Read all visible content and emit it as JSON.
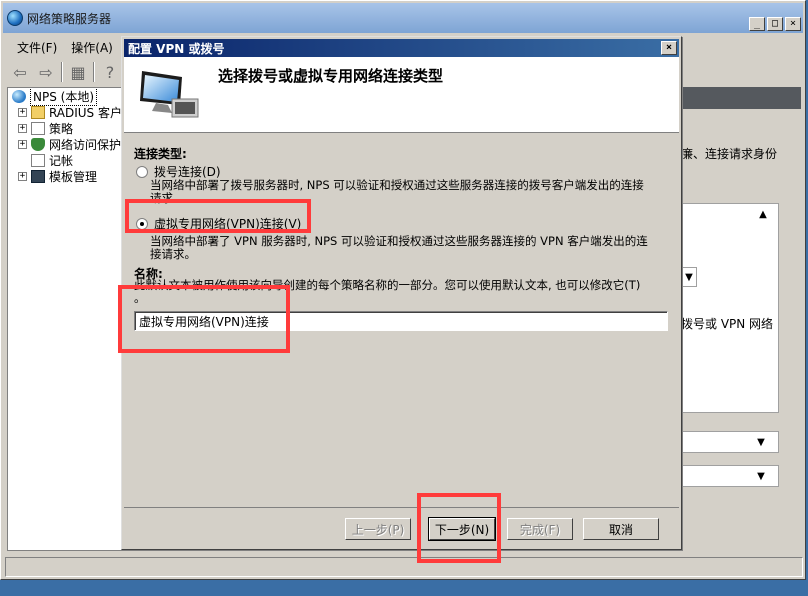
{
  "main_window": {
    "title": "网络策略服务器",
    "buttons": {
      "minimize": "_",
      "maximize": "□",
      "close": "×"
    }
  },
  "menu": {
    "file": "文件(F)",
    "action": "操作(A)"
  },
  "tree": {
    "root": "NPS (本地)",
    "items": [
      {
        "label": "RADIUS 客户",
        "icon": "folder-icon"
      },
      {
        "label": "策略",
        "icon": "document-icon"
      },
      {
        "label": "网络访问保护",
        "icon": "shield-icon"
      },
      {
        "label": "记帐",
        "icon": "document-icon"
      },
      {
        "label": "模板管理",
        "icon": "monitor-icon"
      }
    ]
  },
  "right_pane": {
    "text_top": "廉、连接请求身份",
    "text_mid": "拨号或 VPN 网络"
  },
  "dialog": {
    "title": "配置 VPN 或拨号",
    "heading": "选择拨号或虚拟专用网络连接类型",
    "connection_type_label": "连接类型:",
    "options": [
      {
        "label": "拨号连接(D)",
        "selected": false,
        "desc_line1": "当网络中部署了拨号服务器时, NPS 可以验证和授权通过这些服务器连接的拨号客户端发出的连接",
        "desc_line2": "请求。"
      },
      {
        "label": "虚拟专用网络(VPN)连接(V)",
        "selected": true,
        "desc_line1": "当网络中部署了 VPN 服务器时, NPS 可以验证和授权通过这些服务器连接的 VPN 客户端发出的连",
        "desc_line2": "接请求。"
      }
    ],
    "name_label": "名称:",
    "name_desc_line1": "此默认文本被用作使用该向导创建的每个策略名称的一部分。您可以使用默认文本, 也可以修改它(T)",
    "name_desc_line2": "。",
    "name_value": "虚拟专用网络(VPN)连接",
    "buttons": {
      "back": "上一步(P)",
      "next": "下一步(N)",
      "finish": "完成(F)",
      "cancel": "取消"
    },
    "close": "×"
  },
  "colors": {
    "highlight": "#ff3b3b",
    "desktop": "#3a6ea5",
    "dialog_title": "#0a246a"
  }
}
